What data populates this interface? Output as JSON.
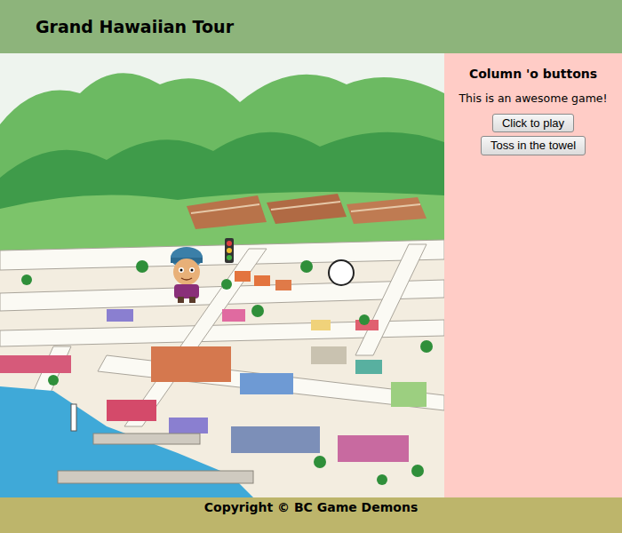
{
  "header": {
    "title": "Grand Hawaiian Tour"
  },
  "sidebar": {
    "heading": "Column 'o buttons",
    "text": "This is an awesome game!",
    "buttons": [
      "Click to play",
      "Toss in the towel"
    ]
  },
  "footer": {
    "text": "Copyright © BC Game Demons"
  }
}
